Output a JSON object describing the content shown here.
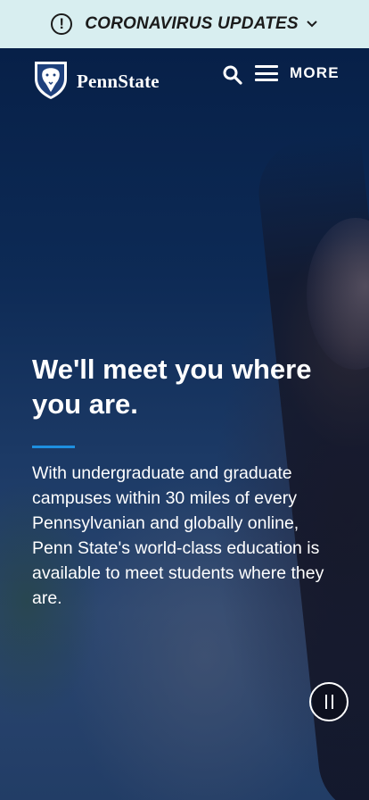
{
  "alert": {
    "icon": "exclamation-circle-icon",
    "label": "CORONAVIRUS UPDATES",
    "chevron": "chevron-down-icon",
    "background": "#d8eef0"
  },
  "header": {
    "logo_text": "PennState",
    "logo_icon": "nittany-lion-shield-icon",
    "search_icon": "search-icon",
    "menu_icon": "menu-icon",
    "menu_label": "MORE"
  },
  "hero": {
    "headline": "We'll meet you where you are.",
    "body": "With undergraduate and graduate campuses within 30 miles of every Pennsylvanian and globally online, Penn State's world-class education is available to meet students where they are.",
    "accent_color": "#1e8fe0",
    "pause_icon": "pause-icon"
  }
}
